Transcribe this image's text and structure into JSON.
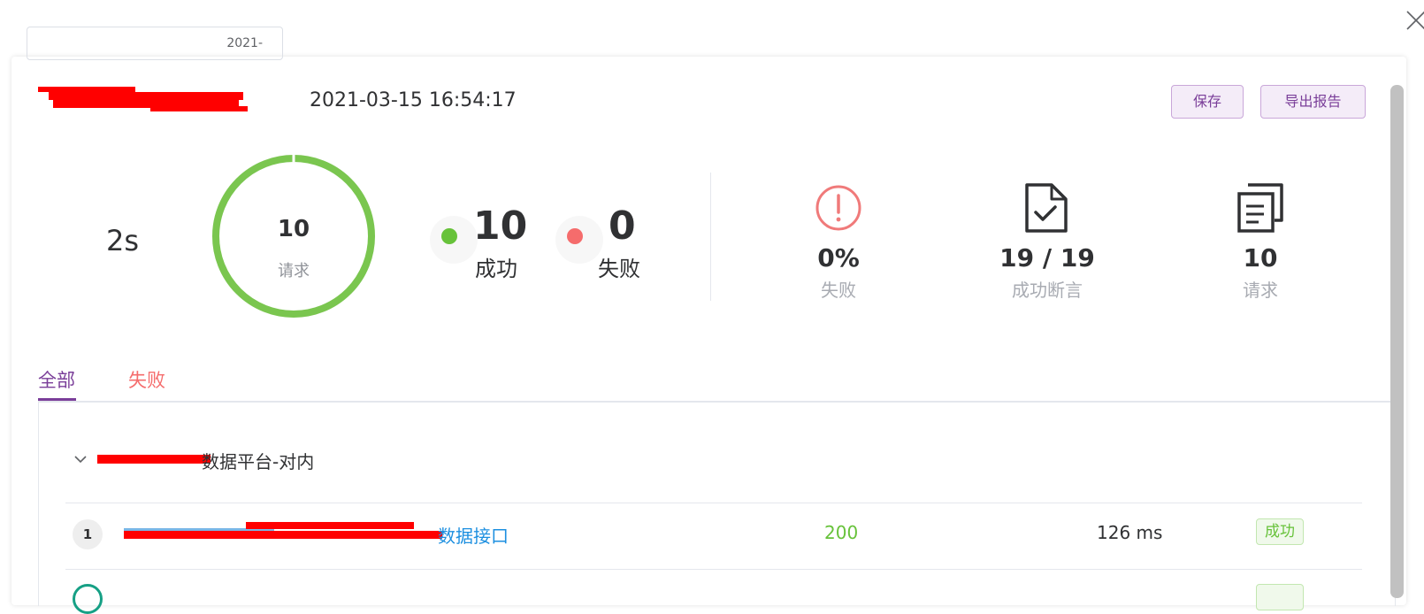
{
  "dialog": {
    "close_icon": "close-icon"
  },
  "header": {
    "report_name": "2021-",
    "run_time": "2021-03-15 16:54:17",
    "save_label": "保存",
    "export_label": "导出报告"
  },
  "summary": {
    "duration": "2s",
    "ring_count": "10",
    "ring_label": "请求",
    "success_count": "10",
    "success_label": "成功",
    "fail_count": "0",
    "fail_label": "失败",
    "success_color": "#67c23a",
    "fail_color": "#f56c6c",
    "success_ratio": 1.0
  },
  "metrics": [
    {
      "icon": "exclamation-circle-icon",
      "value": "0%",
      "label": "失败",
      "color": "#f56c6c"
    },
    {
      "icon": "document-check-icon",
      "value": "19 / 19",
      "label": "成功断言",
      "color": "#303133"
    },
    {
      "icon": "copy-documents-icon",
      "value": "10",
      "label": "请求",
      "color": "#303133"
    }
  ],
  "tabs": [
    {
      "label": "全部",
      "active": true
    },
    {
      "label": "失败",
      "active": false
    }
  ],
  "results": {
    "group_title": "数据平台-对内",
    "rows": [
      {
        "index": "1",
        "name": "数据接口",
        "status": "200",
        "time": "126 ms",
        "result": "成功"
      }
    ]
  },
  "colors": {
    "accent": "#7a3e99",
    "link": "#1c8fe0",
    "success": "#67c23a",
    "danger": "#f56c6c"
  }
}
